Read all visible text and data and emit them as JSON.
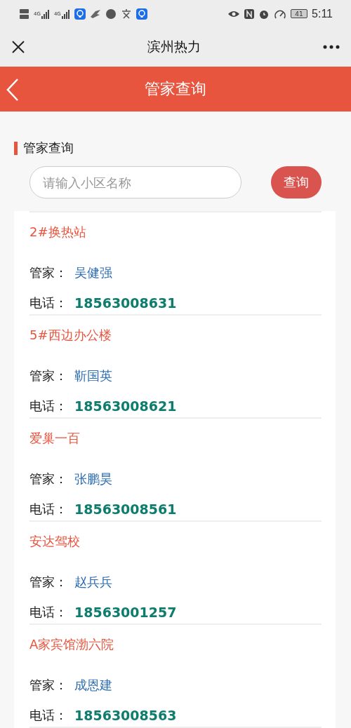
{
  "status_bar": {
    "network_labels": [
      "4G",
      "4G"
    ],
    "battery": "41",
    "time": "5:11"
  },
  "title_bar": {
    "title": "滨州热力"
  },
  "header": {
    "title": "管家查询"
  },
  "section": {
    "title": "管家查询"
  },
  "search": {
    "placeholder": "请输入小区名称",
    "button": "查询"
  },
  "results": [
    {
      "name": "2#换热站",
      "manager_label": "管家：",
      "manager": "吴健强",
      "phone_label": "电话：",
      "phone": "18563008631"
    },
    {
      "name": "5#西边办公楼",
      "manager_label": "管家：",
      "manager": "靳国英",
      "phone_label": "电话：",
      "phone": "18563008621"
    },
    {
      "name": "爱巢一百",
      "manager_label": "管家：",
      "manager": "张鹏昊",
      "phone_label": "电话：",
      "phone": "18563008561"
    },
    {
      "name": "安达驾校",
      "manager_label": "管家：",
      "manager": "赵兵兵",
      "phone_label": "电话：",
      "phone": "18563001257"
    },
    {
      "name": "A家宾馆渤六院",
      "manager_label": "管家：",
      "manager": "成恩建",
      "phone_label": "电话：",
      "phone": "18563008563"
    }
  ]
}
